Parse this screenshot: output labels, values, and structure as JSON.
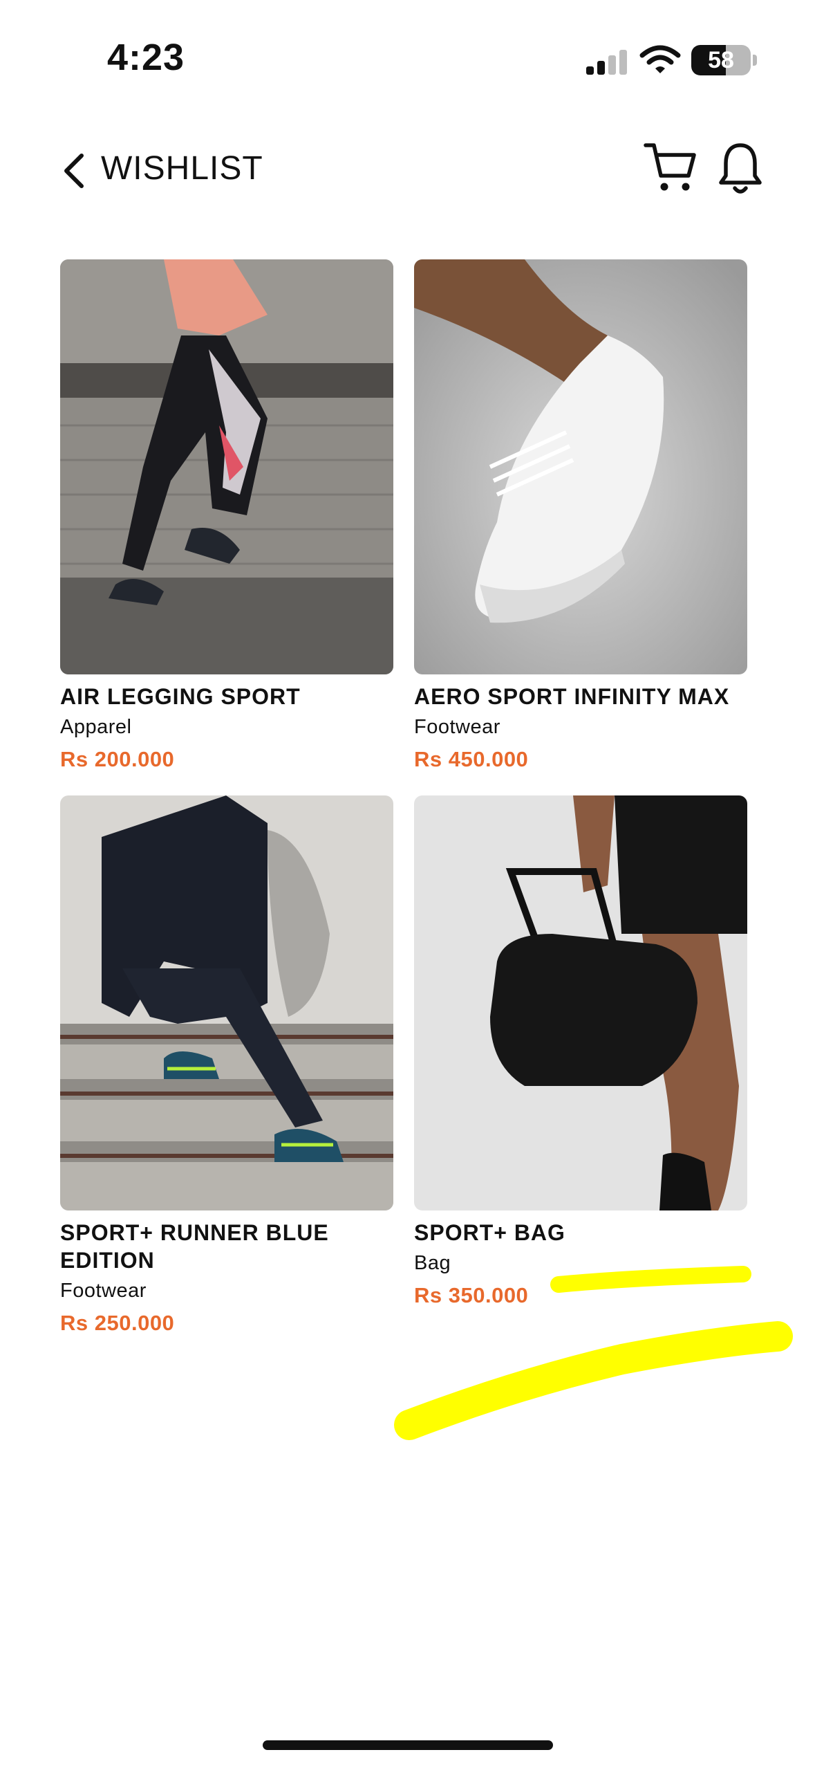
{
  "status_bar": {
    "time": "4:23",
    "battery_level": "58",
    "signal_bars_active": 2,
    "signal_bars_total": 4
  },
  "header": {
    "title": "WISHLIST",
    "back_icon": "chevron-left-icon",
    "cart_icon": "cart-icon",
    "bell_icon": "bell-icon"
  },
  "colors": {
    "price": "#e8692c",
    "text": "#111111",
    "highlight": "#ffff00",
    "background": "#ffffff"
  },
  "products": [
    {
      "name": "AIR LEGGING SPORT",
      "category": "Apparel",
      "price": "Rs 200.000"
    },
    {
      "name": "AERO SPORT INFINITY MAX",
      "category": "Footwear",
      "price": "Rs 450.000"
    },
    {
      "name": "SPORT+ RUNNER BLUE EDITION",
      "category": "Footwear",
      "price": "Rs 250.000"
    },
    {
      "name": "SPORT+ BAG",
      "category": "Bag",
      "price": "Rs 350.000"
    }
  ]
}
